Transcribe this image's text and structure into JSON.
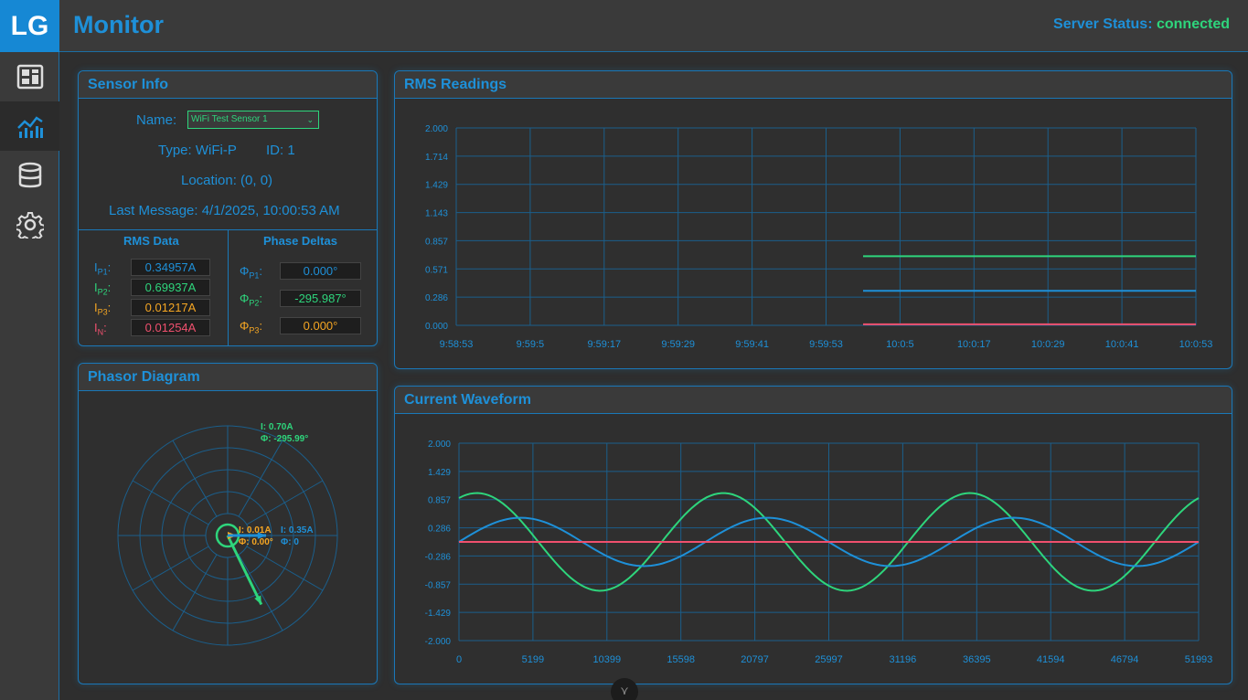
{
  "app": {
    "logo": "LG",
    "title": "Monitor",
    "status_label": "Server Status:",
    "status_value": "connected"
  },
  "sidebar": {
    "items": [
      {
        "icon": "dashboard-icon"
      },
      {
        "icon": "chart-icon",
        "active": true
      },
      {
        "icon": "database-icon"
      },
      {
        "icon": "gear-icon"
      }
    ]
  },
  "sensor_info": {
    "title": "Sensor Info",
    "name_label": "Name:",
    "name_value": "WiFi Test Sensor 1",
    "type_line": "Type: WiFi-P",
    "id_line": "ID: 1",
    "location_line": "Location: (0, 0)",
    "last_message_line": "Last Message: 4/1/2025, 10:00:53 AM",
    "rms_title": "RMS Data",
    "phase_title": "Phase Deltas",
    "rms": [
      {
        "base": "I",
        "sub": "P1",
        "suffix": ":",
        "value": "0.34957A",
        "color": "#1e90d8"
      },
      {
        "base": "I",
        "sub": "P2",
        "suffix": ":",
        "value": "0.69937A",
        "color": "#2ed57c"
      },
      {
        "base": "I",
        "sub": "P3",
        "suffix": ":",
        "value": "0.01217A",
        "color": "#f5a623"
      },
      {
        "base": "I",
        "sub": "N",
        "suffix": ":",
        "value": "0.01254A",
        "color": "#f0506e"
      }
    ],
    "phases": [
      {
        "base": "Φ",
        "sub": "P1",
        "suffix": ":",
        "value": "0.000°",
        "color": "#1e90d8"
      },
      {
        "base": "Φ",
        "sub": "P2",
        "suffix": ":",
        "value": "-295.987°",
        "color": "#2ed57c"
      },
      {
        "base": "Φ",
        "sub": "P3",
        "suffix": ":",
        "value": "0.000°",
        "color": "#f5a623"
      }
    ]
  },
  "phasor": {
    "title": "Phasor Diagram",
    "max_magnitude": 1.0,
    "vectors": [
      {
        "name": "P1",
        "magnitude": 0.35,
        "angle_deg": 0,
        "color": "#1e90d8",
        "label_i": "I: 0.35A",
        "label_phi": "Φ: 0"
      },
      {
        "name": "P2",
        "magnitude": 0.7,
        "angle_deg": -295.99,
        "color": "#2ed57c",
        "label_i": "I: 0.70A",
        "label_phi": "Φ: -295.99°"
      },
      {
        "name": "P3",
        "magnitude": 0.01,
        "angle_deg": 0,
        "color": "#f5a623",
        "label_i": "I: 0.01A",
        "label_phi": "Φ: 0.00°"
      }
    ]
  },
  "rms_chart": {
    "title": "RMS Readings",
    "chart_data": {
      "type": "line",
      "xlabels": [
        "9:58:53",
        "9:59:5",
        "9:59:17",
        "9:59:29",
        "9:59:41",
        "9:59:53",
        "10:0:5",
        "10:0:17",
        "10:0:29",
        "10:0:41",
        "10:0:53"
      ],
      "yticks": [
        "2.000",
        "1.714",
        "1.429",
        "1.143",
        "0.857",
        "0.571",
        "0.286",
        "0.000"
      ],
      "ylim": [
        0,
        2
      ],
      "x_start_fraction": 0.55,
      "series": [
        {
          "color": "#2ed57c",
          "values": [
            0.7,
            0.7,
            0.7,
            0.7,
            0.7,
            0.7
          ]
        },
        {
          "color": "#1e90d8",
          "values": [
            0.35,
            0.35,
            0.35,
            0.35,
            0.35,
            0.35
          ]
        },
        {
          "color": "#f0506e",
          "values": [
            0.01,
            0.01,
            0.01,
            0.01,
            0.01,
            0.01
          ]
        }
      ]
    }
  },
  "waveform_chart": {
    "title": "Current Waveform",
    "chart_data": {
      "type": "line",
      "xlabels": [
        "0",
        "5199",
        "10399",
        "15598",
        "20797",
        "25997",
        "31196",
        "36395",
        "41594",
        "46794",
        "51993"
      ],
      "yticks": [
        "2.000",
        "1.429",
        "0.857",
        "0.286",
        "-0.286",
        "-0.857",
        "-1.429",
        "-2.000"
      ],
      "ylim": [
        -2,
        2
      ],
      "series": [
        {
          "color": "#2ed57c",
          "amplitude": 0.99,
          "cycles": 3.0,
          "phase_deg": 64
        },
        {
          "color": "#1e90d8",
          "amplitude": 0.49,
          "cycles": 3.0,
          "phase_deg": 0
        },
        {
          "color": "#f0506e",
          "amplitude": 0.0,
          "cycles": 3.0,
          "phase_deg": 0,
          "offset": 0.0
        }
      ]
    }
  },
  "misc": {
    "scroll_button": "⋎"
  }
}
